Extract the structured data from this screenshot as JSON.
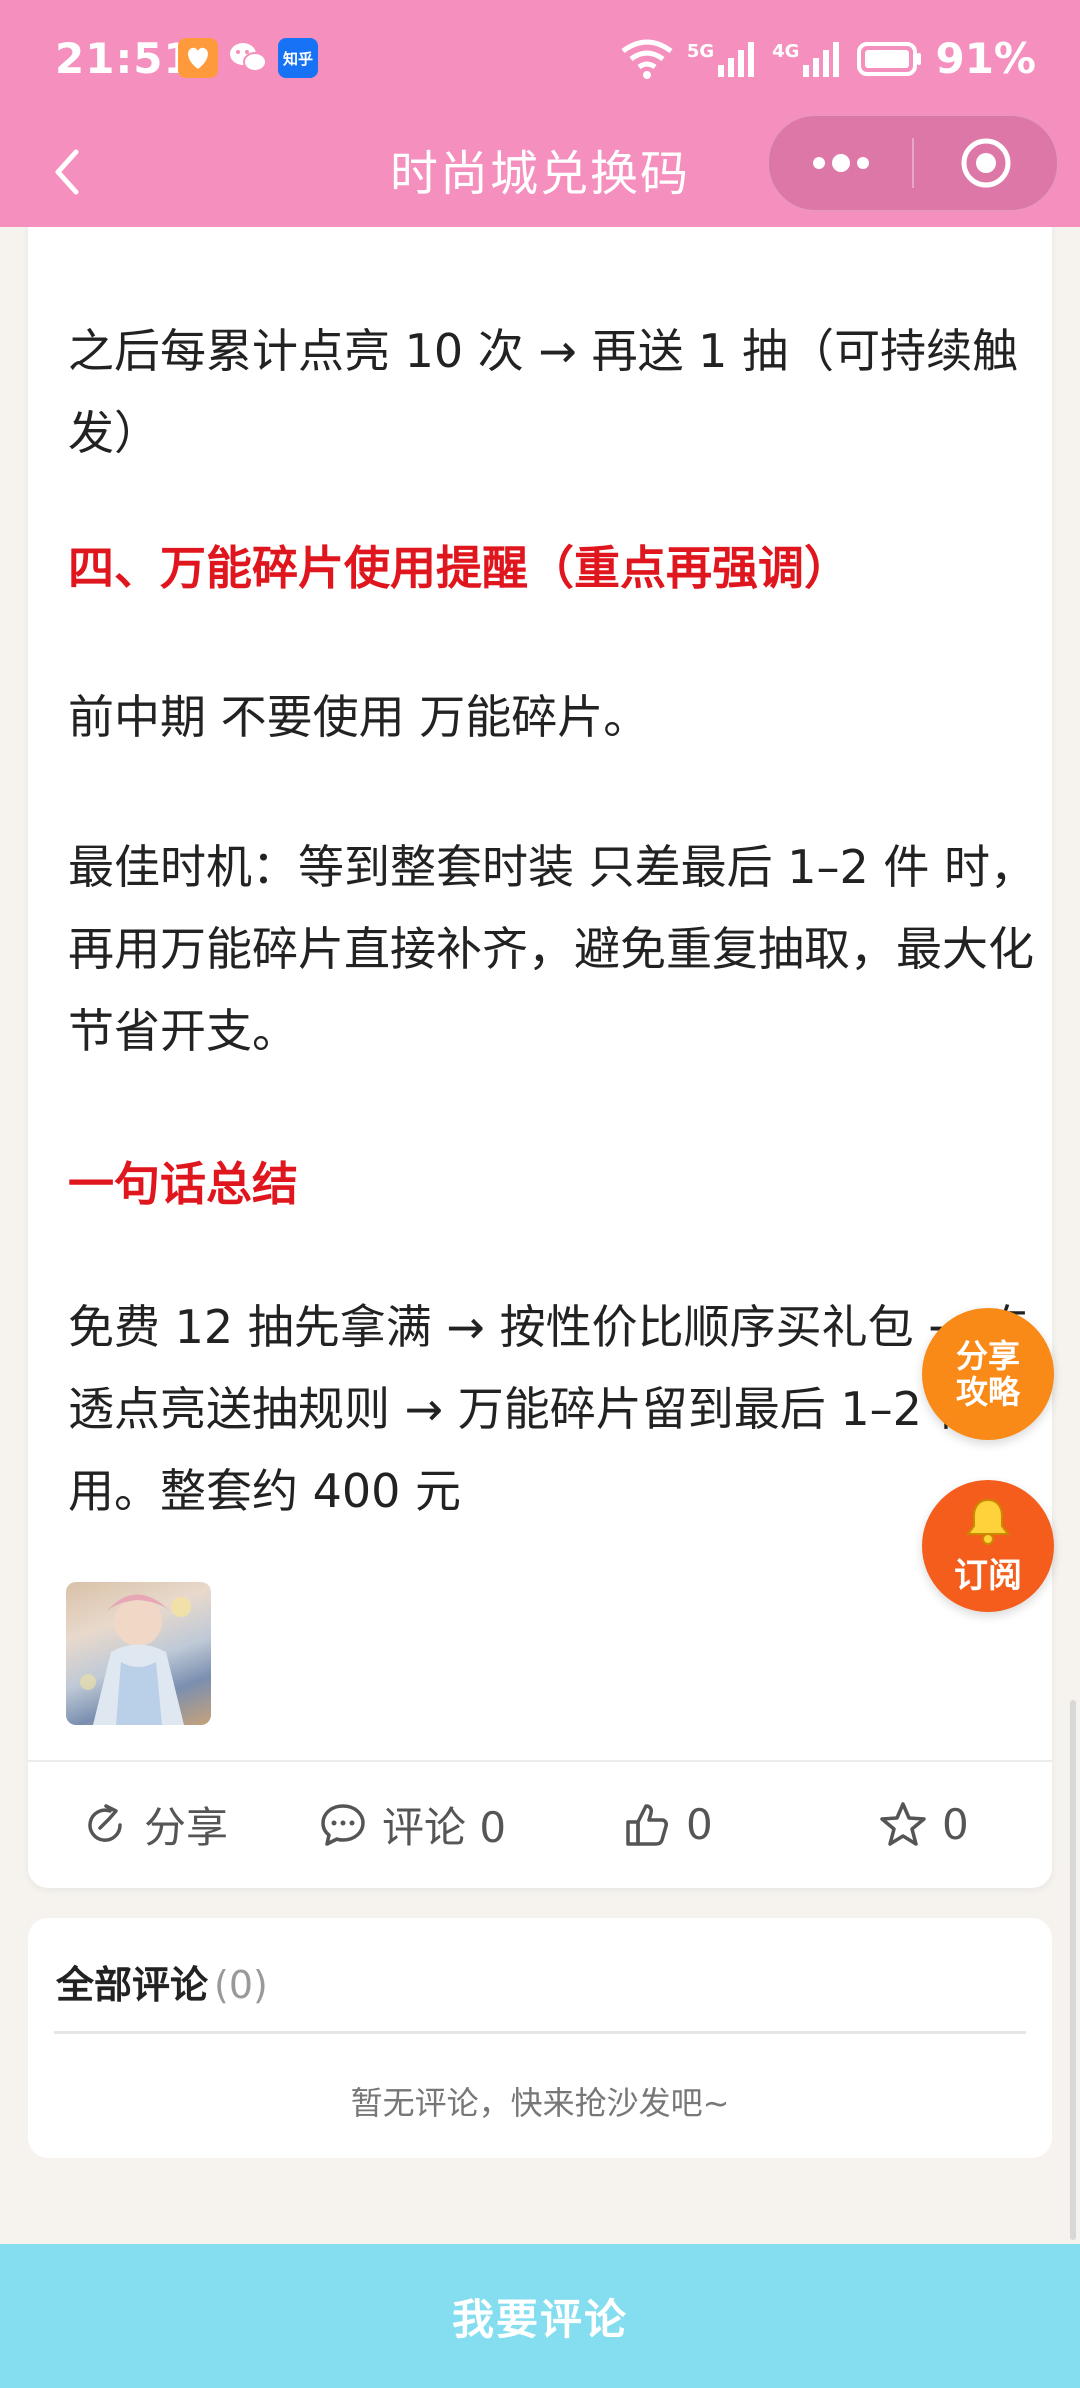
{
  "status_bar": {
    "time": "21:51",
    "battery": "91%",
    "net1": "5G",
    "net2": "4G",
    "zhihu": "知乎"
  },
  "navbar": {
    "title": "时尚城兑换码"
  },
  "article": {
    "para_top": "之后每累计点亮 10 次 → 再送 1 抽（可持续触发）",
    "heading_4": "四、万能碎片使用提醒（重点再强调）",
    "para_no_use": "前中期 不要使用 万能碎片。",
    "para_best_time": "最佳时机：等到整套时装 只差最后 1–2 件 时，再用万能碎片直接补齐，避免重复抽取，最大化节省开支。",
    "heading_summary": "一句话总结",
    "para_summary": "免费 12 抽先拿满 → 按性价比顺序买礼包 → 吃透点亮送抽规则 → 万能碎片留到最后 1–2 件再用。整套约 400 元"
  },
  "actions": {
    "share": "分享",
    "comment": "评论 0",
    "like": "0",
    "favorite": "0"
  },
  "fab": {
    "share_line1": "分享",
    "share_line2": "攻略",
    "subscribe": "订阅"
  },
  "comments": {
    "title": "全部评论",
    "count": "(0)",
    "empty": "暂无评论，快来抢沙发吧~"
  },
  "bottom": {
    "button": "我要评论"
  },
  "colors": {
    "topbar": "#f58fbd",
    "heading_red": "#e0161f",
    "fab_share": "#fa8a18",
    "fab_subscribe": "#f45d1c",
    "bottom_button": "#84def0"
  }
}
